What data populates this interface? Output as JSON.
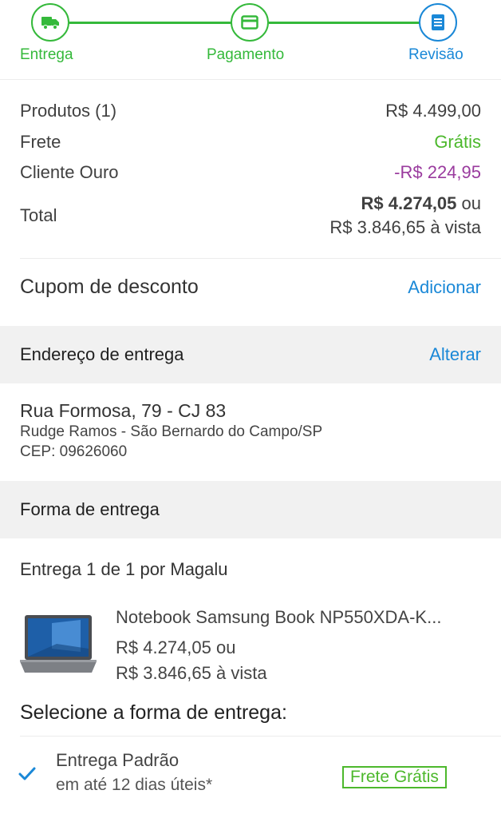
{
  "stepper": {
    "steps": [
      {
        "label": "Entrega",
        "icon": "truck-icon"
      },
      {
        "label": "Pagamento",
        "icon": "credit-card-icon"
      },
      {
        "label": "Revisão",
        "icon": "document-list-icon"
      }
    ],
    "colors": {
      "done": "#35b93b",
      "current": "#1a88d7"
    }
  },
  "summary": {
    "products_label": "Produtos (1)",
    "products_value": "R$ 4.499,00",
    "shipping_label": "Frete",
    "shipping_value": "Grátis",
    "gold_label": "Cliente Ouro",
    "gold_value": "-R$ 224,95",
    "total_label": "Total",
    "total_value": "R$ 4.274,05",
    "total_or": " ou",
    "total_cash": "R$ 3.846,65 à vista"
  },
  "coupon": {
    "label": "Cupom de desconto",
    "action": "Adicionar"
  },
  "address_section": {
    "title": "Endereço de entrega",
    "action": "Alterar",
    "street": "Rua Formosa, 79 - CJ 83",
    "district": "Rudge Ramos - São Bernardo do Campo/SP",
    "cep": "CEP: 09626060"
  },
  "delivery_section": {
    "title": "Forma de entrega",
    "count_prefix": "Entrega ",
    "count": "1 de 1",
    "seller": " por Magalu"
  },
  "product": {
    "name": "Notebook Samsung Book NP550XDA-K...",
    "price": "R$ 4.274,05 ou",
    "cash_price": "R$ 3.846,65 à vista",
    "image_icon": "laptop-icon"
  },
  "shipping_options": {
    "title": "Selecione a forma de entrega:",
    "selected": {
      "name": "Entrega Padrão",
      "eta": "em até 12 dias úteis*",
      "badge": "Frete Grátis"
    }
  }
}
